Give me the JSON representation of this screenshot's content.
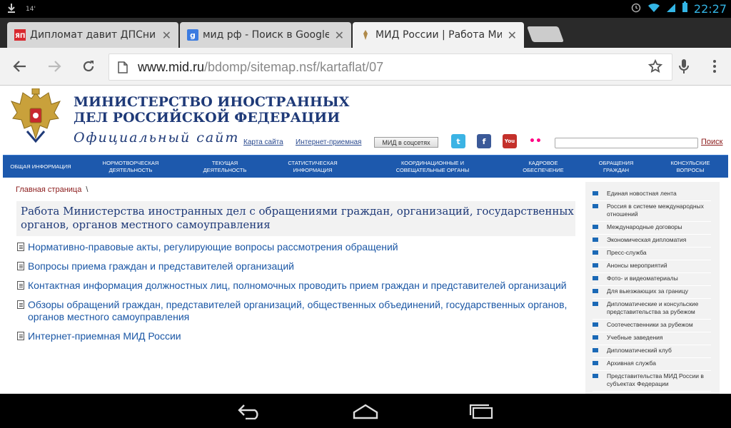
{
  "status": {
    "left_number": "14'",
    "clock": "22:27"
  },
  "tabs": [
    {
      "label": "Дипломат давит ДПСников",
      "favicon": "yap-icon",
      "active": false
    },
    {
      "label": "мид рф - Поиск в Google",
      "favicon": "google-icon",
      "active": false
    },
    {
      "label": "МИД России | Работа Мини",
      "favicon": "mid-icon",
      "active": true
    }
  ],
  "omnibox": {
    "host": "www.mid.ru",
    "path": "/bdomp/sitemap.nsf/kartaflat/07"
  },
  "header": {
    "title": "МИНИСТЕРСТВО ИНОСТРАННЫХ ДЕЛ РОССИЙСКОЙ ФЕДЕРАЦИИ",
    "subtitle": "Официальный сайт",
    "links": {
      "sitemap": "Карта сайта",
      "reception": "Интернет-приемная",
      "social": "МИД в соцсетях"
    },
    "social_icons": {
      "twitter": "t",
      "facebook": "f",
      "youtube": "You",
      "flickr": "••"
    },
    "search_label": "Поиск"
  },
  "nav": [
    "Общая информация",
    "Нормотворческая деятельность",
    "Текущая деятельность",
    "Статистическая информация",
    "Координационные и совещательные органы",
    "Кадровое обеспечение",
    "Обращения граждан",
    "Консульские вопросы"
  ],
  "breadcrumb": {
    "home": "Главная страница",
    "sep": "\\"
  },
  "main": {
    "title": "Работа Министерства иностранных дел с обращениями граждан, организаций, государственных органов, органов местного самоуправления",
    "items": [
      "Нормативно-правовые акты, регулирующие вопросы рассмотрения обращений",
      "Вопросы приема граждан и представителей организаций",
      "Контактная информация должностных лиц, полномочных проводить прием граждан и представителей организаций",
      "Обзоры обращений граждан, представителей организаций, общественных объединений, государственных органов, органов местного самоуправления",
      "Интернет-приемная МИД России"
    ]
  },
  "sidebar": [
    "Единая новостная лента",
    "Россия в системе международных отношений",
    "Международные договоры",
    "Экономическая дипломатия",
    "Пресс-служба",
    "Анонсы мероприятий",
    "Фото- и видеоматериалы",
    "Для выезжающих за границу",
    "Дипломатические и консульские представительства за рубежом",
    "Соотечественники за рубежом",
    "Учебные заведения",
    "Дипломатический клуб",
    "Архивная служба",
    "Представительства МИД России в субъектах Федерации"
  ],
  "colors": {
    "nav_blue": "#1d59ad",
    "title_blue": "#1f3a78",
    "link_blue": "#1b57a5",
    "link_red": "#8b1b1b",
    "holo_blue": "#33b5e5"
  }
}
